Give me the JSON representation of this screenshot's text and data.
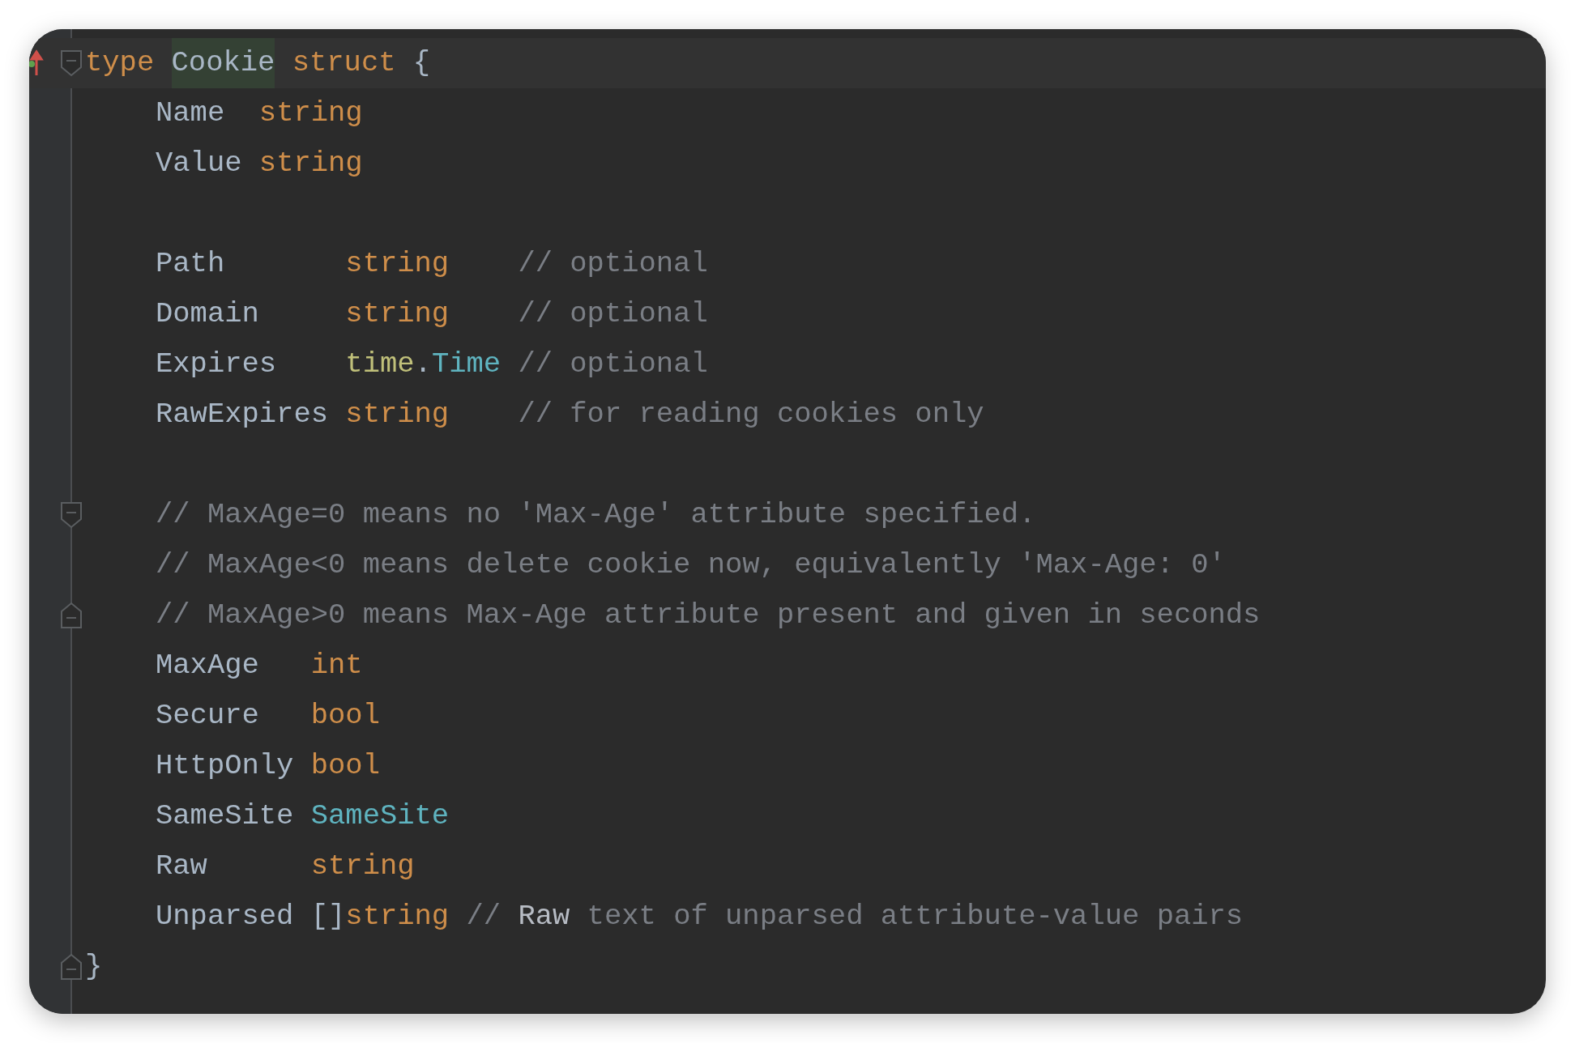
{
  "editor": {
    "lines": [
      {
        "tokens": [
          {
            "text": "type ",
            "kind": "keyword"
          },
          {
            "text": "Cookie",
            "kind": "declared"
          },
          {
            "text": " struct ",
            "kind": "keyword"
          },
          {
            "text": "{",
            "kind": "plain"
          }
        ],
        "fold_start": true,
        "fold_end": false,
        "current": true,
        "gutter_icon": true,
        "children": [
          {
            "tokens": [
              {
                "text": "Name  ",
                "kind": "plain"
              },
              {
                "text": "string",
                "kind": "keyword"
              }
            ],
            "fold_start": false,
            "fold_end": false,
            "current": false,
            "gutter_icon": false
          },
          {
            "tokens": [
              {
                "text": "Value ",
                "kind": "plain"
              },
              {
                "text": "string",
                "kind": "keyword"
              }
            ],
            "fold_start": false,
            "fold_end": false,
            "current": false,
            "gutter_icon": false
          },
          {
            "fold_start": false,
            "fold_end": false,
            "current": false,
            "gutter_icon": false
          },
          {
            "tokens": [
              {
                "text": "Path       ",
                "kind": "plain"
              },
              {
                "text": "string",
                "kind": "keyword"
              },
              {
                "text": "    // optional",
                "kind": "comment"
              }
            ],
            "fold_start": false,
            "fold_end": false,
            "current": false,
            "gutter_icon": false
          },
          {
            "tokens": [
              {
                "text": "Domain     ",
                "kind": "plain"
              },
              {
                "text": "string",
                "kind": "keyword"
              },
              {
                "text": "    // optional",
                "kind": "comment"
              }
            ],
            "fold_start": false,
            "fold_end": false,
            "current": false,
            "gutter_icon": false
          },
          {
            "tokens": [
              {
                "text": "Expires    ",
                "kind": "plain"
              },
              {
                "text": "time",
                "kind": "package"
              },
              {
                "text": ".",
                "kind": "plain"
              },
              {
                "text": "Time",
                "kind": "type"
              },
              {
                "text": " // optional",
                "kind": "comment"
              }
            ],
            "fold_start": false,
            "fold_end": false,
            "current": false,
            "gutter_icon": false
          },
          {
            "tokens": [
              {
                "text": "RawExpires ",
                "kind": "plain"
              },
              {
                "text": "string",
                "kind": "keyword"
              },
              {
                "text": "    // for reading cookies only",
                "kind": "comment"
              }
            ],
            "fold_start": false,
            "fold_end": false,
            "current": false,
            "gutter_icon": false
          },
          {
            "fold_start": false,
            "fold_end": false,
            "current": false,
            "gutter_icon": false
          },
          {
            "tokens": [
              {
                "text": "// MaxAge=0 means no 'Max-Age' attribute specified.",
                "kind": "comment"
              }
            ],
            "fold_start": true,
            "fold_end": false,
            "current": false,
            "gutter_icon": false
          },
          {
            "tokens": [
              {
                "text": "// MaxAge<0 means delete cookie now, equivalently 'Max-Age: 0'",
                "kind": "comment"
              }
            ],
            "fold_start": false,
            "fold_end": false,
            "current": false,
            "gutter_icon": false
          },
          {
            "tokens": [
              {
                "text": "// MaxAge>0 means Max-Age attribute present and given in seconds",
                "kind": "comment"
              }
            ],
            "fold_start": false,
            "fold_end": true,
            "current": false,
            "gutter_icon": false
          },
          {
            "tokens": [
              {
                "text": "MaxAge   ",
                "kind": "plain"
              },
              {
                "text": "int",
                "kind": "keyword"
              }
            ],
            "fold_start": false,
            "fold_end": false,
            "current": false,
            "gutter_icon": false
          },
          {
            "tokens": [
              {
                "text": "Secure   ",
                "kind": "plain"
              },
              {
                "text": "bool",
                "kind": "keyword"
              }
            ],
            "fold_start": false,
            "fold_end": false,
            "current": false,
            "gutter_icon": false
          },
          {
            "tokens": [
              {
                "text": "HttpOnly ",
                "kind": "plain"
              },
              {
                "text": "bool",
                "kind": "keyword"
              }
            ],
            "fold_start": false,
            "fold_end": false,
            "current": false,
            "gutter_icon": false
          },
          {
            "tokens": [
              {
                "text": "SameSite ",
                "kind": "plain"
              },
              {
                "text": "SameSite",
                "kind": "type"
              }
            ],
            "fold_start": false,
            "fold_end": false,
            "current": false,
            "gutter_icon": false
          },
          {
            "tokens": [
              {
                "text": "Raw      ",
                "kind": "plain"
              },
              {
                "text": "string",
                "kind": "keyword"
              }
            ],
            "fold_start": false,
            "fold_end": false,
            "current": false,
            "gutter_icon": false
          },
          {
            "tokens": [
              {
                "text": "Unparsed []",
                "kind": "plain"
              },
              {
                "text": "string",
                "kind": "keyword"
              },
              {
                "text": " // ",
                "kind": "comment"
              },
              {
                "text": "Raw",
                "kind": "comment_ref"
              },
              {
                "text": " text of unparsed attribute-value pairs",
                "kind": "comment"
              }
            ],
            "fold_start": false,
            "fold_end": false,
            "current": false,
            "gutter_icon": false
          }
        ]
      },
      {
        "tokens": [
          {
            "text": "}",
            "kind": "plain"
          }
        ],
        "fold_start": false,
        "fold_end": true,
        "current": false,
        "gutter_icon": false
      }
    ]
  }
}
